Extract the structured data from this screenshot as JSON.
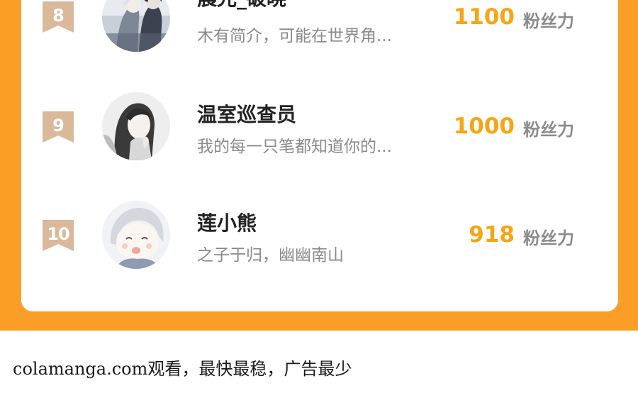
{
  "ranking": {
    "entries": [
      {
        "rank": "8",
        "name": "晨光_破晓",
        "bio": "木有简介，可能在世界角...",
        "fans": "1100",
        "fans_unit": "粉丝力",
        "badge_color": "#d9b99a"
      },
      {
        "rank": "9",
        "name": "温室巡查员",
        "bio": "我的每一只笔都知道你的...",
        "fans": "1000",
        "fans_unit": "粉丝力",
        "badge_color": "#d9b99a"
      },
      {
        "rank": "10",
        "name": "莲小熊",
        "bio": "之子于归，幽幽南山",
        "fans": "918",
        "fans_unit": "粉丝力",
        "badge_color": "#d9b99a"
      }
    ]
  },
  "colors": {
    "frame": "#fb9e28",
    "fans_number": "#f6a516",
    "name": "#222222",
    "bio": "#8a8a8a"
  },
  "footer": {
    "text": "colamanga.com观看，最快最稳，广告最少"
  }
}
